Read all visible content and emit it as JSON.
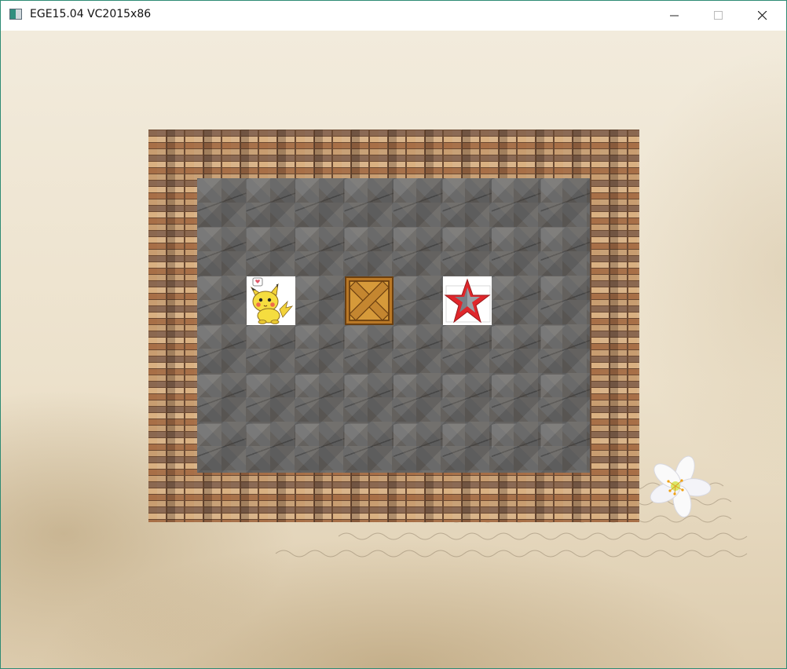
{
  "window": {
    "title": "EGE15.04 VC2015x86",
    "controls": {
      "minimize": "minimize",
      "maximize": "maximize",
      "close": "close"
    }
  },
  "game": {
    "type": "sokoban",
    "grid": {
      "columns": 10,
      "rows": 8
    },
    "wall_texture": "brick",
    "floor_texture": "stone",
    "entities": [
      {
        "kind": "player",
        "icon": "pikachu-icon",
        "col": 2,
        "row": 3
      },
      {
        "kind": "box",
        "icon": "wooden-crate-icon",
        "col": 4,
        "row": 3
      },
      {
        "kind": "goal",
        "icon": "red-star-icon",
        "col": 6,
        "row": 3
      }
    ],
    "background": "vintage-paper-with-flower",
    "colors": {
      "window_border": "#2e8b74",
      "star_red": "#e0262b",
      "crate": "#c98a2c"
    }
  }
}
